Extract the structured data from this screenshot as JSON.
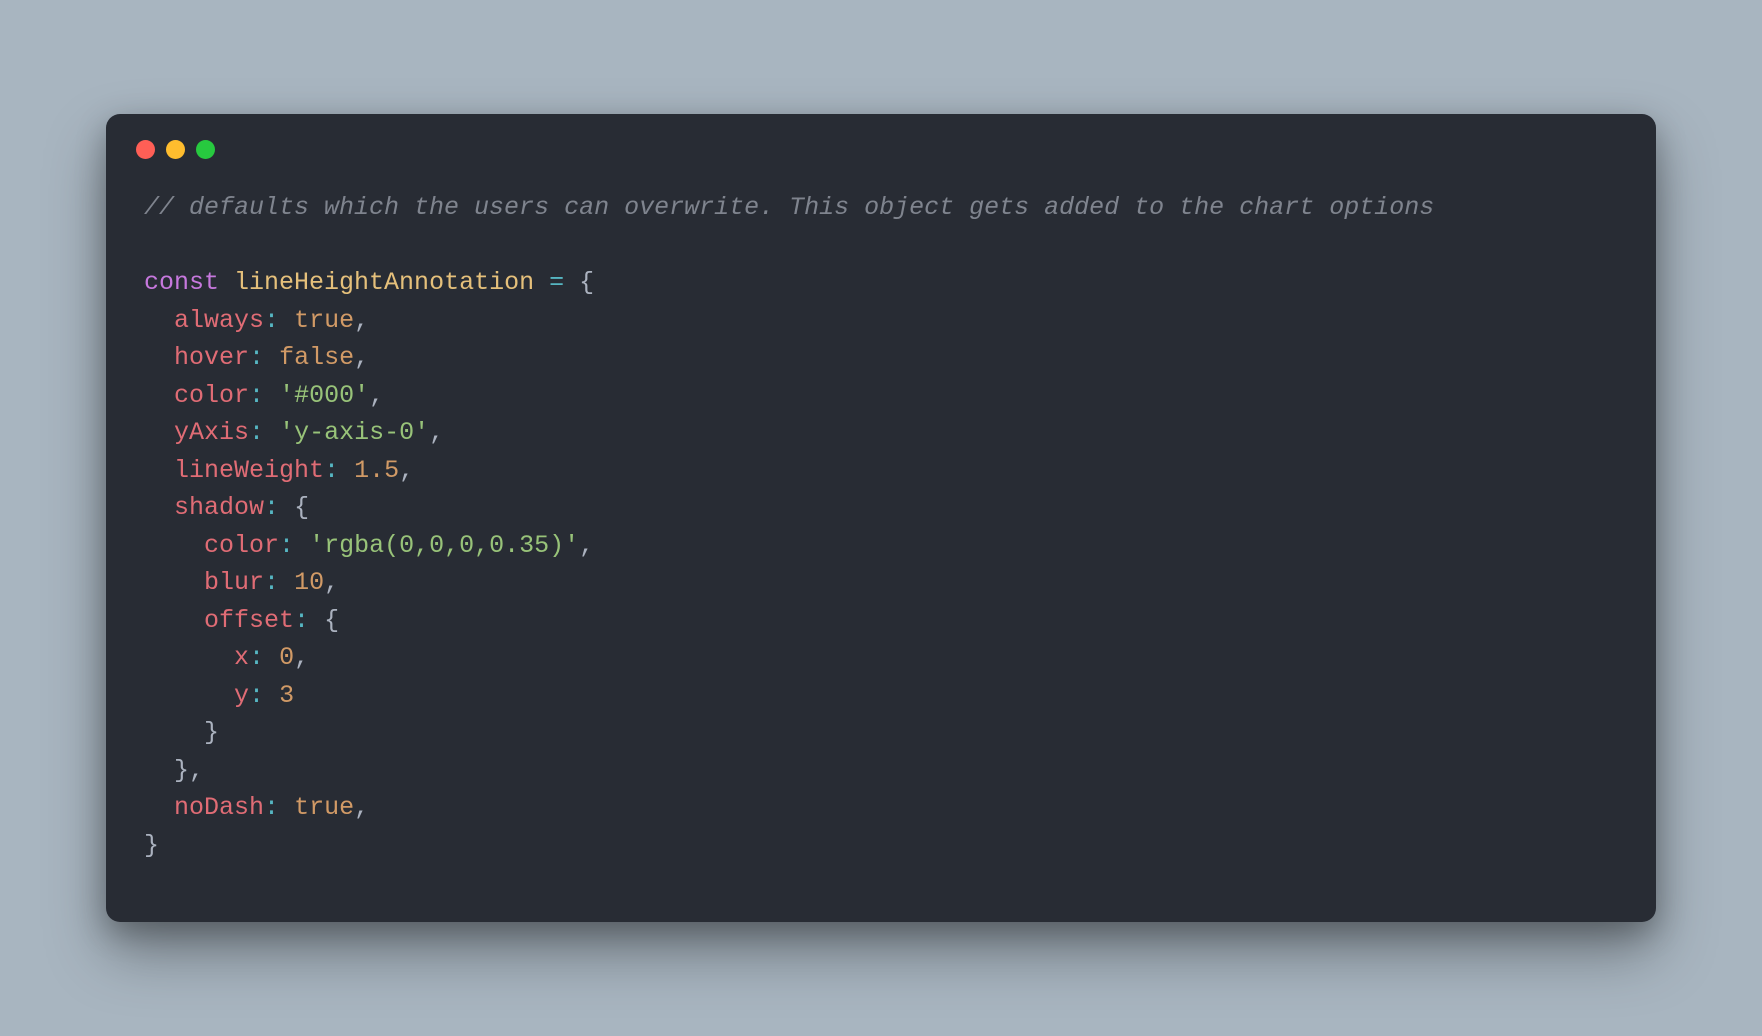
{
  "code": {
    "comment": "// defaults which the users can overwrite. This object gets added to the chart options",
    "const_keyword": "const",
    "var_name": "lineHeightAnnotation",
    "equals": " = ",
    "open_brace": "{",
    "props": {
      "always": {
        "key": "always",
        "value": "true"
      },
      "hover": {
        "key": "hover",
        "value": "false"
      },
      "color": {
        "key": "color",
        "value": "'#000'"
      },
      "yAxis": {
        "key": "yAxis",
        "value": "'y-axis-0'"
      },
      "lineWeight": {
        "key": "lineWeight",
        "value": "1.5"
      },
      "shadow": {
        "key": "shadow",
        "color": {
          "key": "color",
          "value": "'rgba(0,0,0,0.35)'"
        },
        "blur": {
          "key": "blur",
          "value": "10"
        },
        "offset": {
          "key": "offset",
          "x": {
            "key": "x",
            "value": "0"
          },
          "y": {
            "key": "y",
            "value": "3"
          }
        }
      },
      "noDash": {
        "key": "noDash",
        "value": "true"
      }
    },
    "close_brace": "}",
    "colon": ":",
    "comma": ","
  }
}
